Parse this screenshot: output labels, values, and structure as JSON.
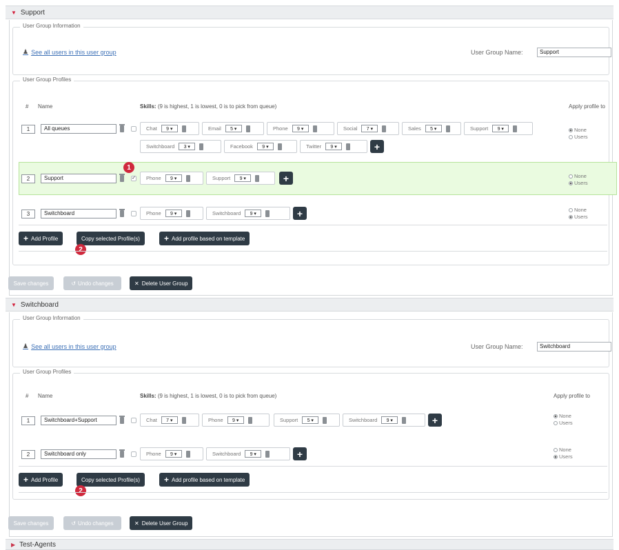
{
  "groups": [
    {
      "title": "Support",
      "info_legend": "User Group Information",
      "see_all_link": "See all users in this user group",
      "name_label": "User Group Name:",
      "name_value": "Support",
      "profiles_legend": "User Group Profiles",
      "col_num": "#",
      "col_name": "Name",
      "skills_label": "Skills:",
      "skills_hint": "(9 is highest, 1 is lowest, 0 is to pick from queue)",
      "apply_label": "Apply profile to",
      "profiles": [
        {
          "num": "1",
          "name": "All queues",
          "checked": false,
          "skills_row1": [
            {
              "name": "Chat",
              "value": "9 ▾"
            },
            {
              "name": "Email",
              "value": "5 ▾"
            },
            {
              "name": "Phone",
              "value": "9 ▾"
            },
            {
              "name": "Social",
              "value": "7 ▾"
            },
            {
              "name": "Sales",
              "value": "5 ▾"
            },
            {
              "name": "Support",
              "value": "9 ▾"
            }
          ],
          "skills_row2": [
            {
              "name": "Switchboard",
              "value": "3 ▾"
            },
            {
              "name": "Facebook",
              "value": "9 ▾"
            },
            {
              "name": "Twitter",
              "value": "9 ▾"
            }
          ],
          "radio_none": "None",
          "radio_users": "Users",
          "selected": "none"
        },
        {
          "num": "2",
          "name": "Support",
          "checked": true,
          "skills_row1": [
            {
              "name": "Phone",
              "value": "9 ▾"
            },
            {
              "name": "Support",
              "value": "9 ▾"
            }
          ],
          "radio_none": "None",
          "radio_users": "Users",
          "selected": "users"
        },
        {
          "num": "3",
          "name": "Switchboard",
          "checked": false,
          "skills_row1": [
            {
              "name": "Phone",
              "value": "9 ▾"
            },
            {
              "name": "Switchboard",
              "value": "9 ▾"
            }
          ],
          "radio_none": "None",
          "radio_users": "Users",
          "selected": "users"
        }
      ],
      "add_profile": "Add Profile",
      "copy_selected": "Copy selected Profile(s)",
      "add_template": "Add profile based on template",
      "save_changes": "Save changes",
      "undo_changes": "Undo changes",
      "delete_group": "Delete User Group"
    },
    {
      "title": "Switchboard",
      "info_legend": "User Group Information",
      "see_all_link": "See all users in this user group",
      "name_label": "User Group Name:",
      "name_value": "Switchboard",
      "profiles_legend": "User Group Profiles",
      "col_num": "#",
      "col_name": "Name",
      "skills_label": "Skills:",
      "skills_hint": "(9 is highest, 1 is lowest, 0 is to pick from queue)",
      "apply_label": "Apply profile to",
      "profiles": [
        {
          "num": "1",
          "name": "Switchboard+Support",
          "checked": false,
          "skills_row1": [
            {
              "name": "Chat",
              "value": "7 ▾"
            },
            {
              "name": "Phone",
              "value": "9 ▾"
            },
            {
              "name": "Support",
              "value": "5 ▾"
            },
            {
              "name": "Switchboard",
              "value": "9 ▾"
            }
          ],
          "radio_none": "None",
          "radio_users": "Users",
          "selected": "none"
        },
        {
          "num": "2",
          "name": "Switchboard only",
          "checked": false,
          "skills_row1": [
            {
              "name": "Phone",
              "value": "9 ▾"
            },
            {
              "name": "Switchboard",
              "value": "9 ▾"
            }
          ],
          "radio_none": "None",
          "radio_users": "Users",
          "selected": "users"
        }
      ],
      "add_profile": "Add Profile",
      "copy_selected": "Copy selected Profile(s)",
      "add_template": "Add profile based on template",
      "save_changes": "Save changes",
      "undo_changes": "Undo changes",
      "delete_group": "Delete User Group"
    }
  ],
  "collapsed_group": {
    "title": "Test-Agents"
  },
  "badges": {
    "one": "1",
    "two": "2"
  },
  "colors": {
    "accent_red": "#d0293d",
    "dark_button": "#2f3b45",
    "highlight_row": "#eafbe0"
  }
}
